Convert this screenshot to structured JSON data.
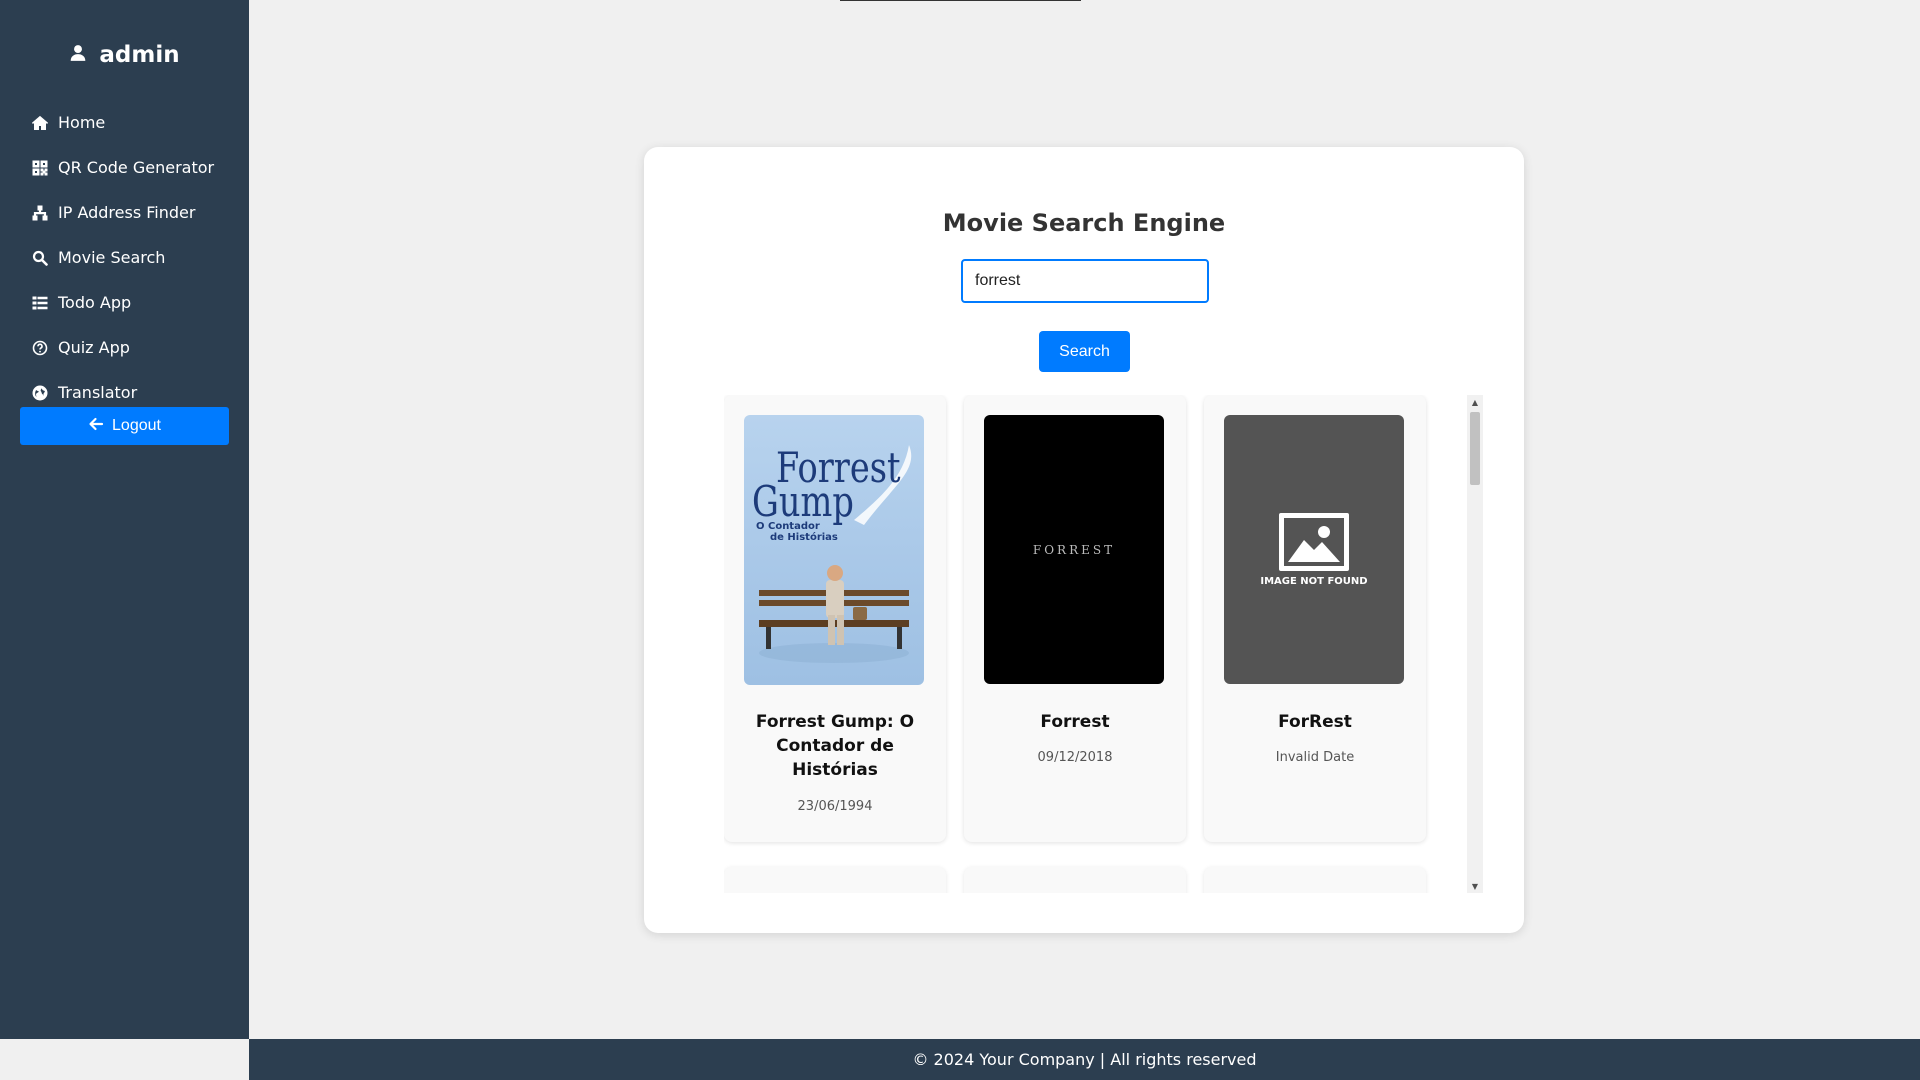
{
  "sidebar": {
    "username": "admin",
    "user_icon": "user-icon",
    "items": [
      {
        "label": "Home",
        "icon": "home-icon"
      },
      {
        "label": "QR Code Generator",
        "icon": "qr-code-icon"
      },
      {
        "label": "IP Address Finder",
        "icon": "network-icon"
      },
      {
        "label": "Movie Search",
        "icon": "search-icon"
      },
      {
        "label": "Todo App",
        "icon": "list-icon"
      },
      {
        "label": "Quiz App",
        "icon": "question-circle-icon"
      },
      {
        "label": "Translator",
        "icon": "globe-icon"
      }
    ],
    "logout_label": "Logout"
  },
  "main": {
    "title": "Movie Search Engine",
    "search": {
      "value": "forrest",
      "button_label": "Search"
    },
    "results": [
      {
        "title": "Forrest Gump: O Contador de Histórias",
        "date": "23/06/1994",
        "poster": {
          "heading_line1": "Forrest",
          "heading_line2": "Gump",
          "subtitle_line1": "O Contador",
          "subtitle_line2": "de Histórias"
        }
      },
      {
        "title": "Forrest",
        "date": "09/12/2018",
        "poster": {
          "text": "FORREST"
        }
      },
      {
        "title": "ForRest",
        "date": "Invalid Date",
        "poster": {
          "text": "IMAGE NOT FOUND"
        }
      }
    ]
  },
  "footer": {
    "text": "© 2024 Your Company | All rights reserved"
  },
  "colors": {
    "sidebar_bg": "#2c3e50",
    "accent": "#007bff",
    "page_bg": "#f0f0f0"
  }
}
